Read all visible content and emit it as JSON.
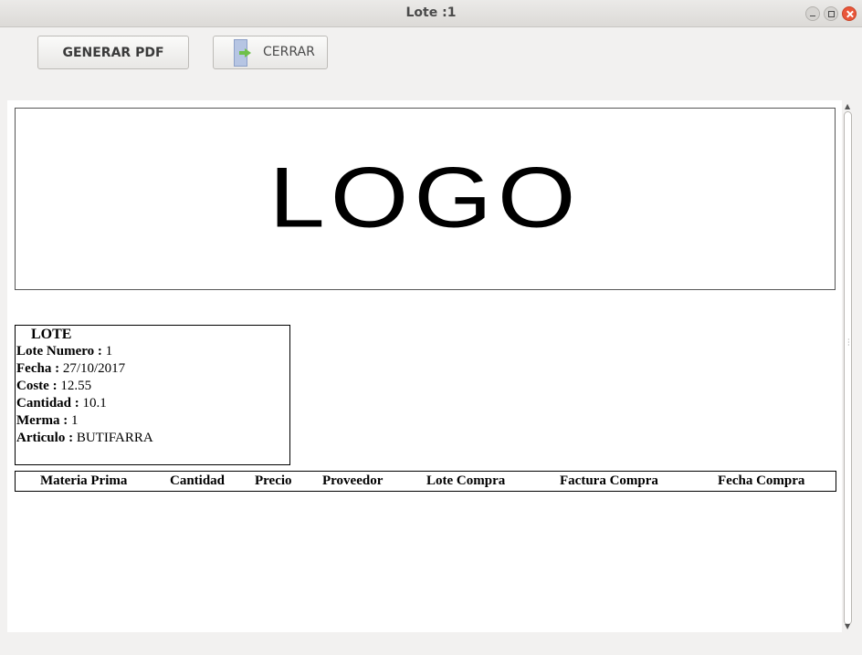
{
  "window": {
    "title": "Lote :1"
  },
  "toolbar": {
    "generate_pdf_label": "GENERAR PDF",
    "close_label": "CERRAR"
  },
  "report": {
    "logo_text": "LOGO",
    "lote": {
      "title": "LOTE",
      "fields": [
        {
          "label": "Lote Numero :",
          "value": "1"
        },
        {
          "label": "Fecha :",
          "value": "27/10/2017"
        },
        {
          "label": "Coste :",
          "value": "12.55"
        },
        {
          "label": "Cantidad :",
          "value": "10.1"
        },
        {
          "label": "Merma :",
          "value": "1"
        },
        {
          "label": "Articulo :",
          "value": "BUTIFARRA"
        }
      ]
    },
    "table": {
      "columns": [
        "Materia Prima",
        "Cantidad",
        "Precio",
        "Proveedor",
        "Lote Compra",
        "Factura Compra",
        "Fecha Compra"
      ],
      "rows": []
    }
  },
  "icons": {
    "close_button_icon": "exit-door-icon",
    "window_controls": [
      "minimize-icon",
      "maximize-icon",
      "close-icon"
    ]
  }
}
